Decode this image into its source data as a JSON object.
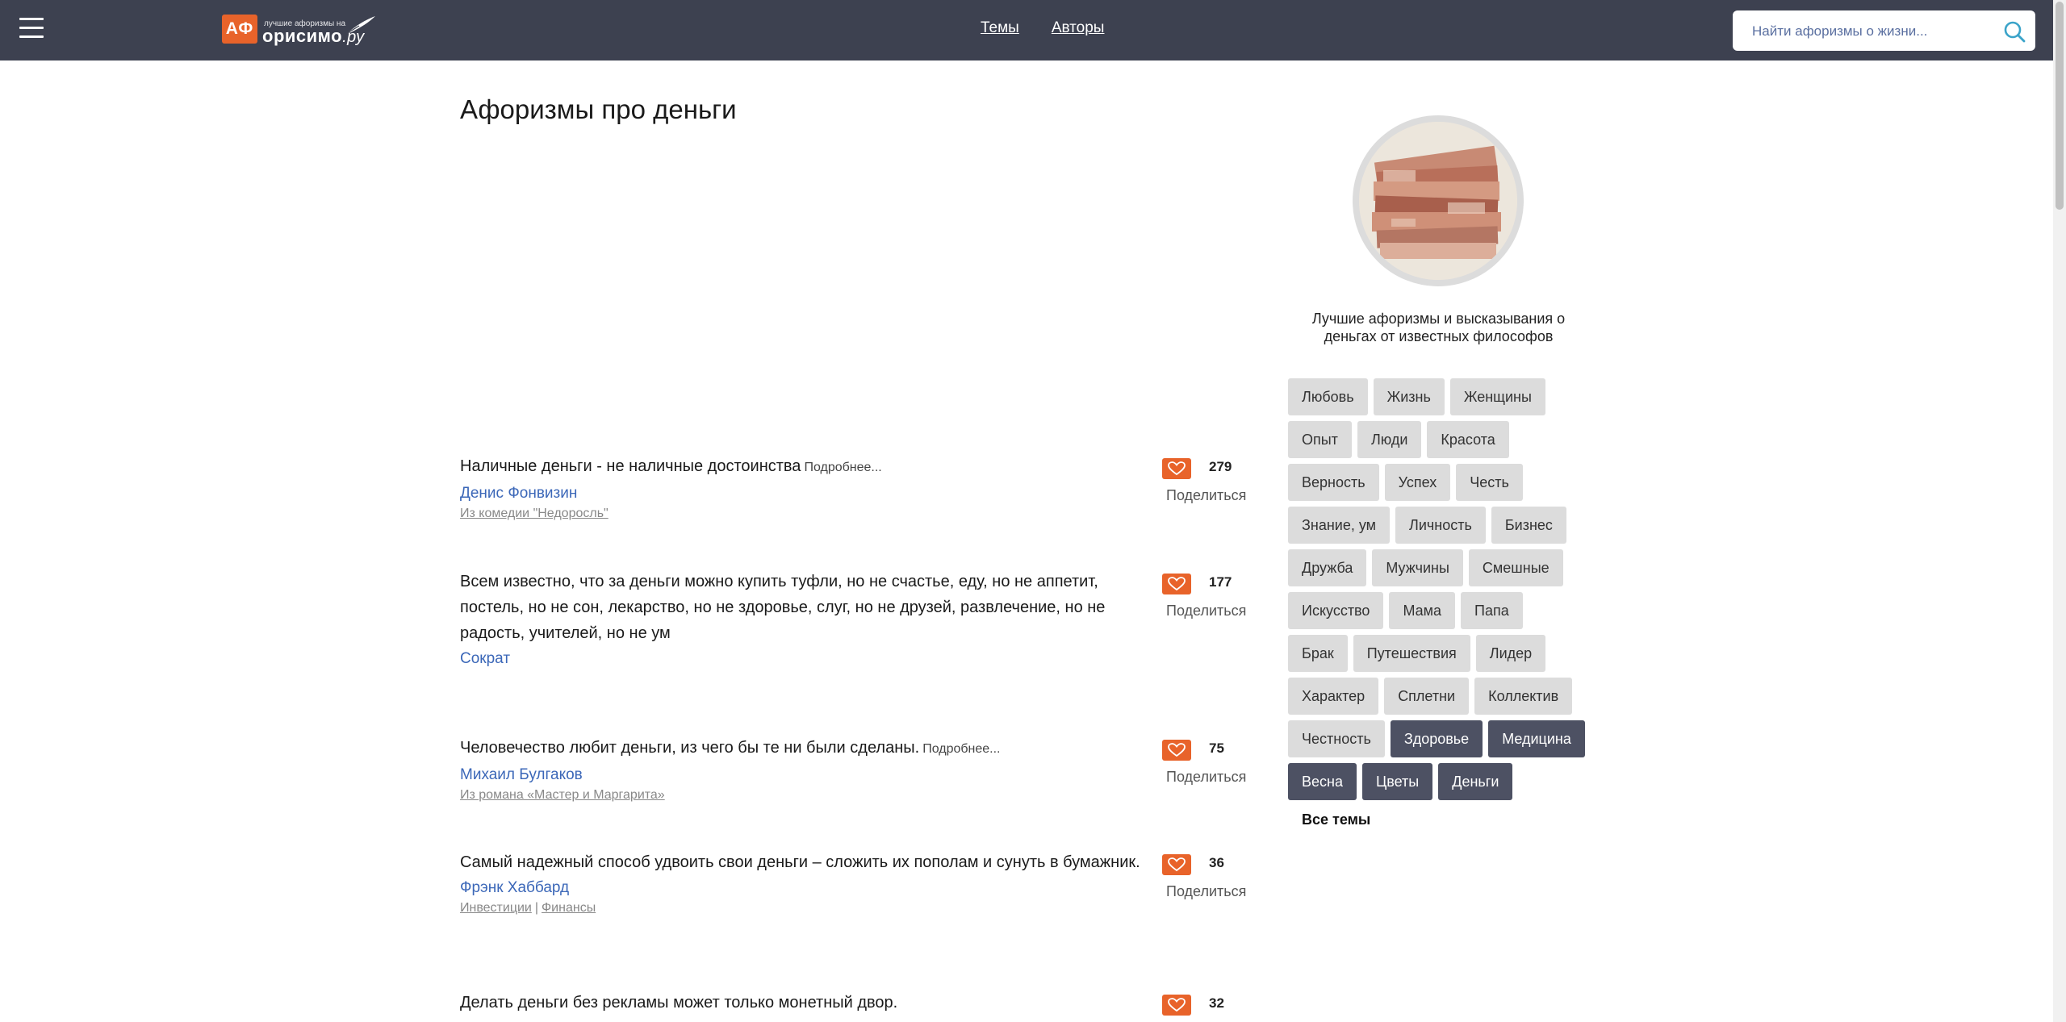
{
  "header": {
    "logo_badge": "АФ",
    "logo_small": "лучшие афоризмы на",
    "logo_big": "орисимо",
    "logo_suffix": ".ру",
    "nav": [
      "Темы",
      "Авторы"
    ],
    "search_placeholder": "Найти афоризмы о жизни..."
  },
  "page": {
    "title": "Афоризмы про деньги"
  },
  "quotes": [
    {
      "text": "Наличные деньги - не наличные достоинства",
      "more": "Подробнее...",
      "author": "Денис Фонвизин",
      "sources": [
        "Из комедии \"Недоросль\""
      ],
      "likes": "279",
      "share": "Поделиться"
    },
    {
      "text": "Всем известно, что за деньги можно купить туфли, но не счастье, еду, но не аппетит, постель, но не сон, лекарство, но не здоровье, слуг, но не друзей, развлечение, но не радость, учителей, но не ум",
      "more": "",
      "author": "Сократ",
      "sources": [],
      "likes": "177",
      "share": "Поделиться"
    },
    {
      "text": "Человечество любит деньги, из чего бы те ни были сделаны.",
      "more": "Подробнее...",
      "author": "Михаил Булгаков",
      "sources": [
        "Из романа «Мастер и Маргарита»"
      ],
      "likes": "75",
      "share": "Поделиться"
    },
    {
      "text": "Самый надежный способ удвоить свои деньги – сложить их пополам и сунуть в бумажник.",
      "more": "",
      "author": "Фрэнк Хаббард",
      "sources": [
        "Инвестиции",
        "Финансы"
      ],
      "likes": "36",
      "share": "Поделиться"
    },
    {
      "text": "Делать деньги без рекламы может только монетный двор.",
      "more": "",
      "author": "",
      "sources": [],
      "likes": "32",
      "share": ""
    }
  ],
  "sidebar": {
    "description": "Лучшие афоризмы и высказывания о деньгах от известных философов",
    "tag_rows": [
      [
        {
          "label": "Любовь",
          "dark": false
        },
        {
          "label": "Жизнь",
          "dark": false
        },
        {
          "label": "Женщины",
          "dark": false
        }
      ],
      [
        {
          "label": "Опыт",
          "dark": false
        },
        {
          "label": "Люди",
          "dark": false
        },
        {
          "label": "Красота",
          "dark": false
        }
      ],
      [
        {
          "label": "Верность",
          "dark": false
        },
        {
          "label": "Успех",
          "dark": false
        },
        {
          "label": "Честь",
          "dark": false
        }
      ],
      [
        {
          "label": "Знание, ум",
          "dark": false
        },
        {
          "label": "Личность",
          "dark": false
        },
        {
          "label": "Бизнес",
          "dark": false
        }
      ],
      [
        {
          "label": "Дружба",
          "dark": false
        },
        {
          "label": "Мужчины",
          "dark": false
        },
        {
          "label": "Смешные",
          "dark": false
        }
      ],
      [
        {
          "label": "Искусство",
          "dark": false
        },
        {
          "label": "Мама",
          "dark": false
        },
        {
          "label": "Папа",
          "dark": false
        }
      ],
      [
        {
          "label": "Брак",
          "dark": false
        },
        {
          "label": "Путешествия",
          "dark": false
        },
        {
          "label": "Лидер",
          "dark": false
        }
      ],
      [
        {
          "label": "Характер",
          "dark": false
        },
        {
          "label": "Сплетни",
          "dark": false
        },
        {
          "label": "Коллектив",
          "dark": false
        }
      ],
      [
        {
          "label": "Честность",
          "dark": false
        },
        {
          "label": "Здоровье",
          "dark": true
        },
        {
          "label": "Медицина",
          "dark": true
        }
      ],
      [
        {
          "label": "Весна",
          "dark": true
        },
        {
          "label": "Цветы",
          "dark": true
        },
        {
          "label": "Деньги",
          "dark": true
        }
      ]
    ],
    "all_topics": "Все темы"
  },
  "colors": {
    "header_bg": "#3d4150",
    "accent": "#e8632a",
    "link": "#3b67b8",
    "tag_dark": "#4d5163",
    "tag_light": "#dcdcdc"
  }
}
